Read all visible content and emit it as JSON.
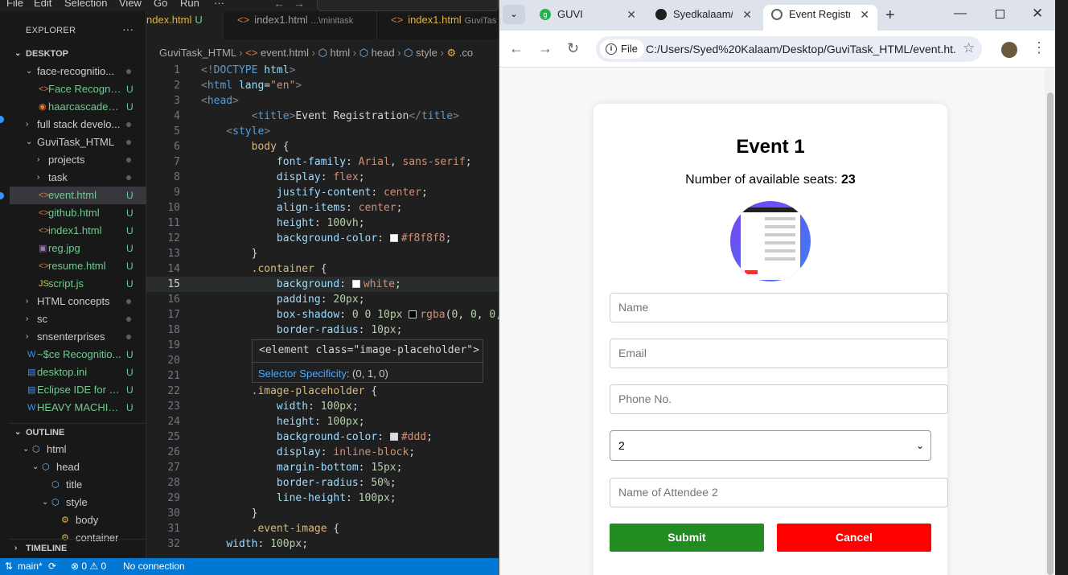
{
  "vscode": {
    "menu": [
      "File",
      "Edit",
      "Selection",
      "View",
      "Go",
      "Run",
      "···"
    ],
    "explorer_title": "EXPLORER",
    "explorer_more": "···",
    "section_desktop": "DESKTOP",
    "tree": [
      {
        "label": "face-recognitio...",
        "status": "dot",
        "kind": "folder-open",
        "indent": 1
      },
      {
        "label": "Face Recogniti...",
        "status": "U",
        "kind": "html",
        "indent": 2
      },
      {
        "label": "haarcascade_fr...",
        "status": "U",
        "kind": "rss",
        "indent": 2
      },
      {
        "label": "full stack develo...",
        "status": "dot",
        "kind": "folder",
        "indent": 1
      },
      {
        "label": "GuviTask_HTML",
        "status": "dot",
        "kind": "folder-open",
        "indent": 1
      },
      {
        "label": "projects",
        "status": "dot",
        "kind": "folder",
        "indent": 2
      },
      {
        "label": "task",
        "status": "dot",
        "kind": "folder",
        "indent": 2
      },
      {
        "label": "event.html",
        "status": "U",
        "kind": "html",
        "indent": 2,
        "selected": true
      },
      {
        "label": "github.html",
        "status": "U",
        "kind": "html",
        "indent": 2
      },
      {
        "label": "index1.html",
        "status": "U",
        "kind": "html",
        "indent": 2
      },
      {
        "label": "reg.jpg",
        "status": "U",
        "kind": "img",
        "indent": 2
      },
      {
        "label": "resume.html",
        "status": "U",
        "kind": "html",
        "indent": 2
      },
      {
        "label": "script.js",
        "status": "U",
        "kind": "js",
        "indent": 2
      },
      {
        "label": "HTML concepts",
        "status": "dot",
        "kind": "folder",
        "indent": 1
      },
      {
        "label": "sc",
        "status": "dot",
        "kind": "folder",
        "indent": 1
      },
      {
        "label": "snsenterprises",
        "status": "dot",
        "kind": "folder",
        "indent": 1
      },
      {
        "label": "~$ce Recognitio...",
        "status": "U",
        "kind": "word",
        "indent": 1
      },
      {
        "label": "desktop.ini",
        "status": "U",
        "kind": "ini",
        "indent": 1
      },
      {
        "label": "Eclipse IDE for E...",
        "status": "U",
        "kind": "ini",
        "indent": 1
      },
      {
        "label": "HEAVY MACHIN...",
        "status": "U",
        "kind": "word",
        "indent": 1
      }
    ],
    "section_outline": "OUTLINE",
    "outline": [
      {
        "label": "html",
        "indent": 1,
        "chev": "v"
      },
      {
        "label": "head",
        "indent": 2,
        "chev": "v"
      },
      {
        "label": "title",
        "indent": 3,
        "chev": ""
      },
      {
        "label": "style",
        "indent": 3,
        "chev": "v"
      },
      {
        "label": "body",
        "indent": 4,
        "chev": "",
        "css": true
      },
      {
        "label": "container",
        "indent": 4,
        "chev": "",
        "css": true
      }
    ],
    "section_timeline": "TIMELINE",
    "tabs": [
      {
        "label": "ndex.html",
        "mark": "U",
        "path": ""
      },
      {
        "label": "index1.html",
        "mark": "",
        "path": "...\\minitask"
      },
      {
        "label": "index1.html",
        "mark": "",
        "path": "GuviTas"
      }
    ],
    "breadcrumb": [
      "GuviTask_HTML",
      "event.html",
      "html",
      "head",
      "style",
      ".co"
    ],
    "code": [
      {
        "n": "1",
        "html": "<span class=\"pu\">&lt;!</span><span class=\"tg\">DOCTYPE</span> <span class=\"at\">html</span><span class=\"pu\">&gt;</span>"
      },
      {
        "n": "2",
        "html": "<span class=\"pu\">&lt;</span><span class=\"tg\">html</span> <span class=\"at\">lang</span>=<span class=\"sv\">\"en\"</span><span class=\"pu\">&gt;</span>"
      },
      {
        "n": "3",
        "html": "<span class=\"pu\">&lt;</span><span class=\"tg\">head</span><span class=\"pu\">&gt;</span>"
      },
      {
        "n": "4",
        "html": "        <span class=\"pu\">&lt;</span><span class=\"tg\">title</span><span class=\"pu\">&gt;</span>Event Registration<span class=\"pu\">&lt;/</span><span class=\"tg\">title</span><span class=\"pu\">&gt;</span>"
      },
      {
        "n": "5",
        "html": "    <span class=\"pu\">&lt;</span><span class=\"tg\">style</span><span class=\"pu\">&gt;</span>"
      },
      {
        "n": "6",
        "html": "        <span class=\"sel2\">body</span> {"
      },
      {
        "n": "7",
        "html": "            <span class=\"pr\">font-family</span>: <span class=\"vv\">Arial</span>, <span class=\"vv\">sans-serif</span>;"
      },
      {
        "n": "8",
        "html": "            <span class=\"pr\">display</span>: <span class=\"vv\">flex</span>;"
      },
      {
        "n": "9",
        "html": "            <span class=\"pr\">justify-content</span>: <span class=\"vv\">center</span>;"
      },
      {
        "n": "10",
        "html": "            <span class=\"pr\">align-items</span>: <span class=\"vv\">center</span>;"
      },
      {
        "n": "11",
        "html": "            <span class=\"pr\">height</span>: <span class=\"nm\">100vh</span>;"
      },
      {
        "n": "12",
        "html": "            <span class=\"pr\">background-color</span>: <span class=\"sw\" style=\"background:#f8f8f8\"></span><span class=\"vv\">#f8f8f8</span>;"
      },
      {
        "n": "13",
        "html": "        }"
      },
      {
        "n": "14",
        "html": "        <span class=\"sel2\">.container</span> {"
      },
      {
        "n": "15",
        "html": "            <span class=\"pr\">background</span>: <span class=\"sw\" style=\"background:#fff\"></span><span class=\"vv\">white</span>;",
        "cur": true
      },
      {
        "n": "16",
        "html": "            <span class=\"pr\">padding</span>: <span class=\"nm\">20px</span>;"
      },
      {
        "n": "17",
        "html": "            <span class=\"pr\">box-shadow</span>: <span class=\"nm\">0 0 10px</span> <span class=\"sw\" style=\"background:#000\"></span><span class=\"vv\">rgba</span>(<span class=\"nm\">0</span>, <span class=\"nm\">0</span>, <span class=\"nm\">0</span>,"
      },
      {
        "n": "18",
        "html": "            <span class=\"pr\">border-radius</span>: <span class=\"nm\">10px</span>;"
      },
      {
        "n": "19",
        "html": ""
      },
      {
        "n": "20",
        "html": ""
      },
      {
        "n": "21",
        "html": ""
      },
      {
        "n": "22",
        "html": "        <span class=\"sel2\">.image-placeholder</span> {"
      },
      {
        "n": "23",
        "html": "            <span class=\"pr\">width</span>: <span class=\"nm\">100px</span>;"
      },
      {
        "n": "24",
        "html": "            <span class=\"pr\">height</span>: <span class=\"nm\">100px</span>;"
      },
      {
        "n": "25",
        "html": "            <span class=\"pr\">background-color</span>: <span class=\"sw\" style=\"background:#ddd\"></span><span class=\"vv\">#ddd</span>;"
      },
      {
        "n": "26",
        "html": "            <span class=\"pr\">display</span>: <span class=\"vv\">inline-block</span>;"
      },
      {
        "n": "27",
        "html": "            <span class=\"pr\">margin-bottom</span>: <span class=\"nm\">15px</span>;"
      },
      {
        "n": "28",
        "html": "            <span class=\"pr\">border-radius</span>: <span class=\"nm\">50%</span>;"
      },
      {
        "n": "29",
        "html": "            <span class=\"pr\">line-height</span>: <span class=\"nm\">100px</span>;"
      },
      {
        "n": "30",
        "html": "        }"
      },
      {
        "n": "31",
        "html": "        <span class=\"sel2\">.event-image</span> {"
      },
      {
        "n": "32",
        "html": "    <span class=\"pr\">width</span>: <span class=\"nm\">100px</span>;"
      }
    ],
    "hover_element": "<element class=\"image-placeholder\">",
    "hover_specificity_label": "Selector Specificity",
    "hover_specificity_value": ": (0, 1, 0)",
    "status": {
      "branch": "main*",
      "sync": "⟳",
      "problems": "⊗ 0 ⚠ 0",
      "connection": "No connection"
    }
  },
  "browser": {
    "tabs": [
      {
        "title": "GUVI",
        "favicon_color": "#24b24b",
        "favicon_text": "g"
      },
      {
        "title": "Syedkalaam/e",
        "favicon_color": "#1f1f1f",
        "favicon_text": ""
      },
      {
        "title": "Event Registra",
        "favicon_color": "#5f6368",
        "favicon_text": ""
      }
    ],
    "new_tab": "+",
    "url_chip": "File",
    "url": "C:/Users/Syed%20Kalaam/Desktop/GuviTask_HTML/event.ht...",
    "page": {
      "title": "Event 1",
      "seats_label": "Number of available seats: ",
      "seats_value": "23",
      "name_placeholder": "Name",
      "email_placeholder": "Email",
      "phone_placeholder": "Phone No.",
      "attendees_selected": "2",
      "attendee2_placeholder": "Name of Attendee 2",
      "submit_label": "Submit",
      "cancel_label": "Cancel",
      "submit_color": "#228b22",
      "cancel_color": "#ff0000"
    }
  }
}
